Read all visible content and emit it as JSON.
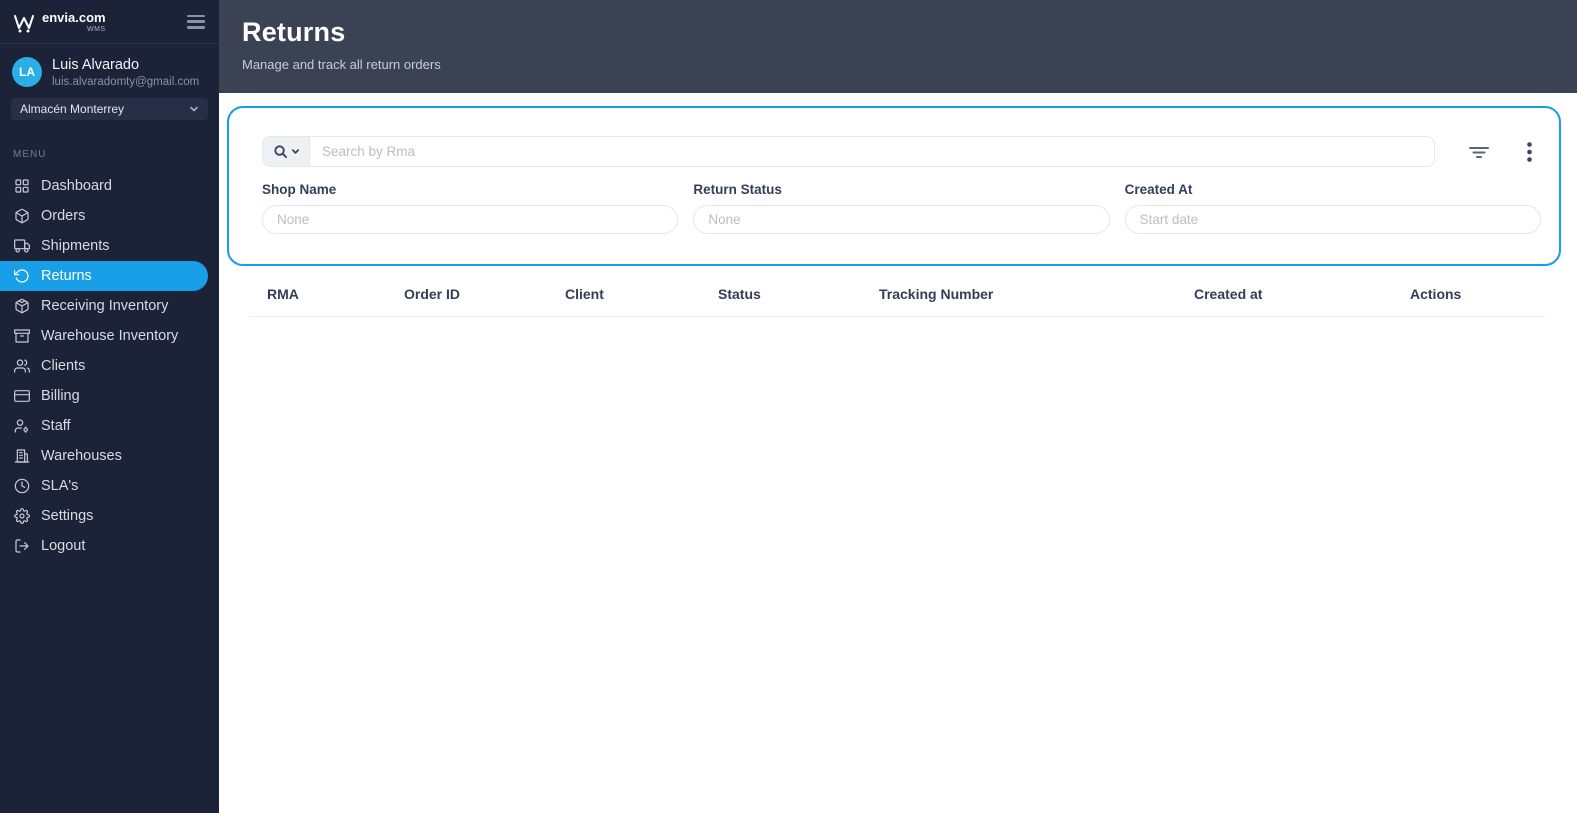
{
  "brand": {
    "name": "envia.com",
    "product": "WMS"
  },
  "user": {
    "initials": "LA",
    "name": "Luis Alvarado",
    "email": "luis.alvaradomty@gmail.com"
  },
  "warehouse_selector": {
    "value": "Almacén Monterrey"
  },
  "sidebar": {
    "section_label": "MENU",
    "items": [
      {
        "label": "Dashboard",
        "icon": "dashboard-icon",
        "active": false
      },
      {
        "label": "Orders",
        "icon": "package-icon",
        "active": false
      },
      {
        "label": "Shipments",
        "icon": "truck-icon",
        "active": false
      },
      {
        "label": "Returns",
        "icon": "return-arrow-icon",
        "active": true
      },
      {
        "label": "Receiving Inventory",
        "icon": "receiving-box-icon",
        "active": false
      },
      {
        "label": "Warehouse Inventory",
        "icon": "archive-icon",
        "active": false
      },
      {
        "label": "Clients",
        "icon": "users-icon",
        "active": false
      },
      {
        "label": "Billing",
        "icon": "credit-card-icon",
        "active": false
      },
      {
        "label": "Staff",
        "icon": "user-gear-icon",
        "active": false
      },
      {
        "label": "Warehouses",
        "icon": "building-icon",
        "active": false
      },
      {
        "label": "SLA's",
        "icon": "clock-icon",
        "active": false
      },
      {
        "label": "Settings",
        "icon": "gear-icon",
        "active": false
      },
      {
        "label": "Logout",
        "icon": "logout-icon",
        "active": false
      }
    ]
  },
  "header": {
    "title": "Returns",
    "subtitle": "Manage and track all return orders"
  },
  "filters": {
    "search": {
      "placeholder": "Search by Rma"
    },
    "fields": [
      {
        "label": "Shop Name",
        "placeholder": "None"
      },
      {
        "label": "Return Status",
        "placeholder": "None"
      },
      {
        "label": "Created At",
        "placeholder": "Start date"
      }
    ]
  },
  "table": {
    "columns": [
      "RMA",
      "Order ID",
      "Client",
      "Status",
      "Tracking Number",
      "Created at",
      "Actions"
    ],
    "rows": []
  },
  "colors": {
    "accent_blue": "#189de8",
    "sidebar_bg": "#1c2237",
    "header_bg": "#3b4254",
    "avatar_blue": "#29aee6"
  }
}
